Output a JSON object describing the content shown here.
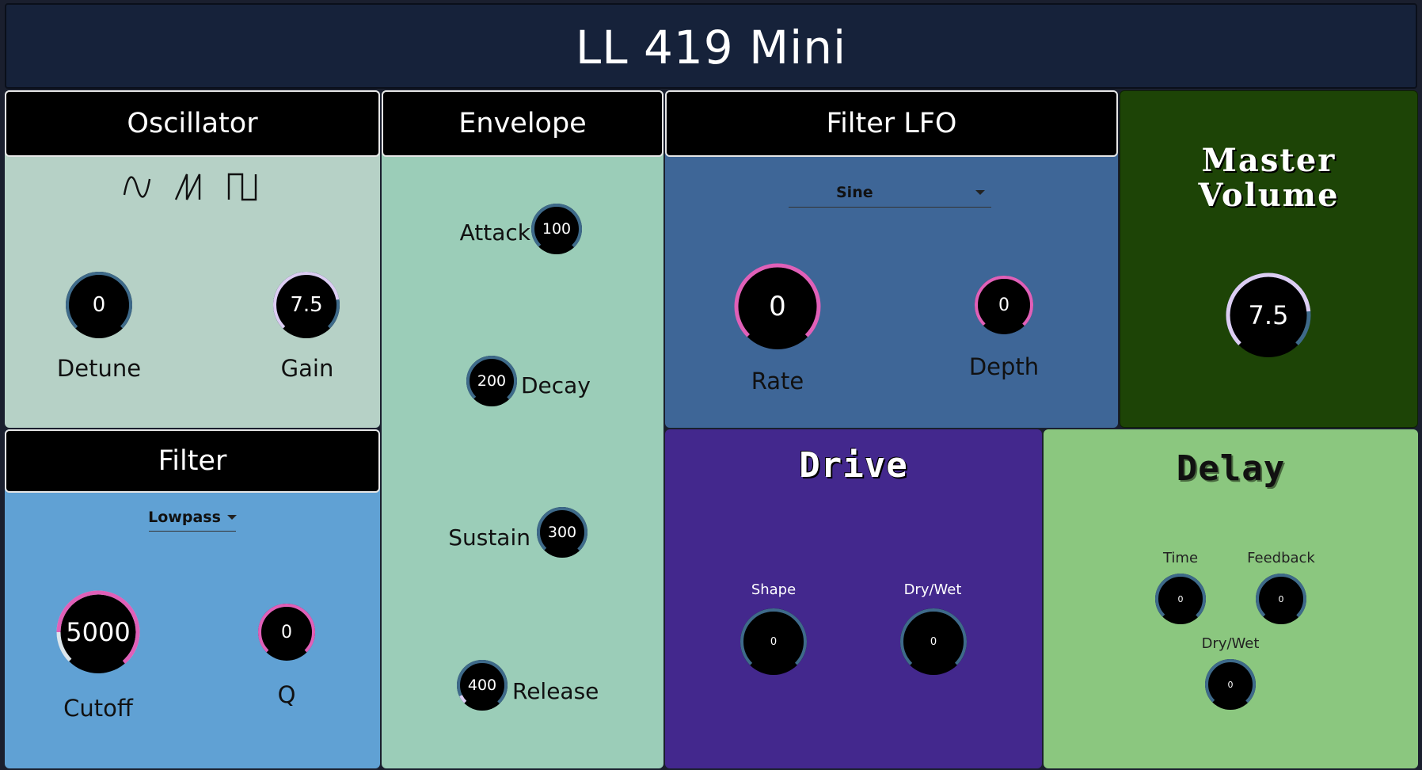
{
  "app": {
    "title": "LL 419 Mini"
  },
  "oscillator": {
    "title": "Oscillator",
    "waveforms": [
      "sine-icon",
      "saw-icon",
      "square-icon"
    ],
    "detune": {
      "label": "Detune",
      "value": "0"
    },
    "gain": {
      "label": "Gain",
      "value": "7.5"
    }
  },
  "filter": {
    "title": "Filter",
    "type": "Lowpass",
    "cutoff": {
      "label": "Cutoff",
      "value": "5000"
    },
    "q": {
      "label": "Q",
      "value": "0"
    }
  },
  "envelope": {
    "title": "Envelope",
    "attack": {
      "label": "Attack",
      "value": "100"
    },
    "decay": {
      "label": "Decay",
      "value": "200"
    },
    "sustain": {
      "label": "Sustain",
      "value": "300"
    },
    "release": {
      "label": "Release",
      "value": "400"
    }
  },
  "filter_lfo": {
    "title": "Filter LFO",
    "waveform": "Sine",
    "rate": {
      "label": "Rate",
      "value": "0"
    },
    "depth": {
      "label": "Depth",
      "value": "0"
    }
  },
  "master": {
    "title_line1": "Master",
    "title_line2": "Volume",
    "volume": {
      "value": "7.5"
    }
  },
  "drive": {
    "title": "Drive",
    "shape": {
      "label": "Shape",
      "value": "0"
    },
    "drywet": {
      "label": "Dry/Wet",
      "value": "0"
    }
  },
  "delay": {
    "title": "Delay",
    "time": {
      "label": "Time",
      "value": "0"
    },
    "feedback": {
      "label": "Feedback",
      "value": "0"
    },
    "drywet": {
      "label": "Dry/Wet",
      "value": "0"
    }
  },
  "colors": {
    "header_bg": "#16223a",
    "oscillator_bg": "#b6d1c6",
    "filter_bg": "#60a1d4",
    "envelope_bg": "#9bcdb8",
    "lfo_bg": "#3e6697",
    "master_bg": "#1d4406",
    "drive_bg": "#43288d",
    "delay_bg": "#8bc77f",
    "knob_ring_blue": "#3e6a8a",
    "knob_ring_pink": "#e060b8",
    "knob_ring_lavender": "#dccdf2"
  }
}
